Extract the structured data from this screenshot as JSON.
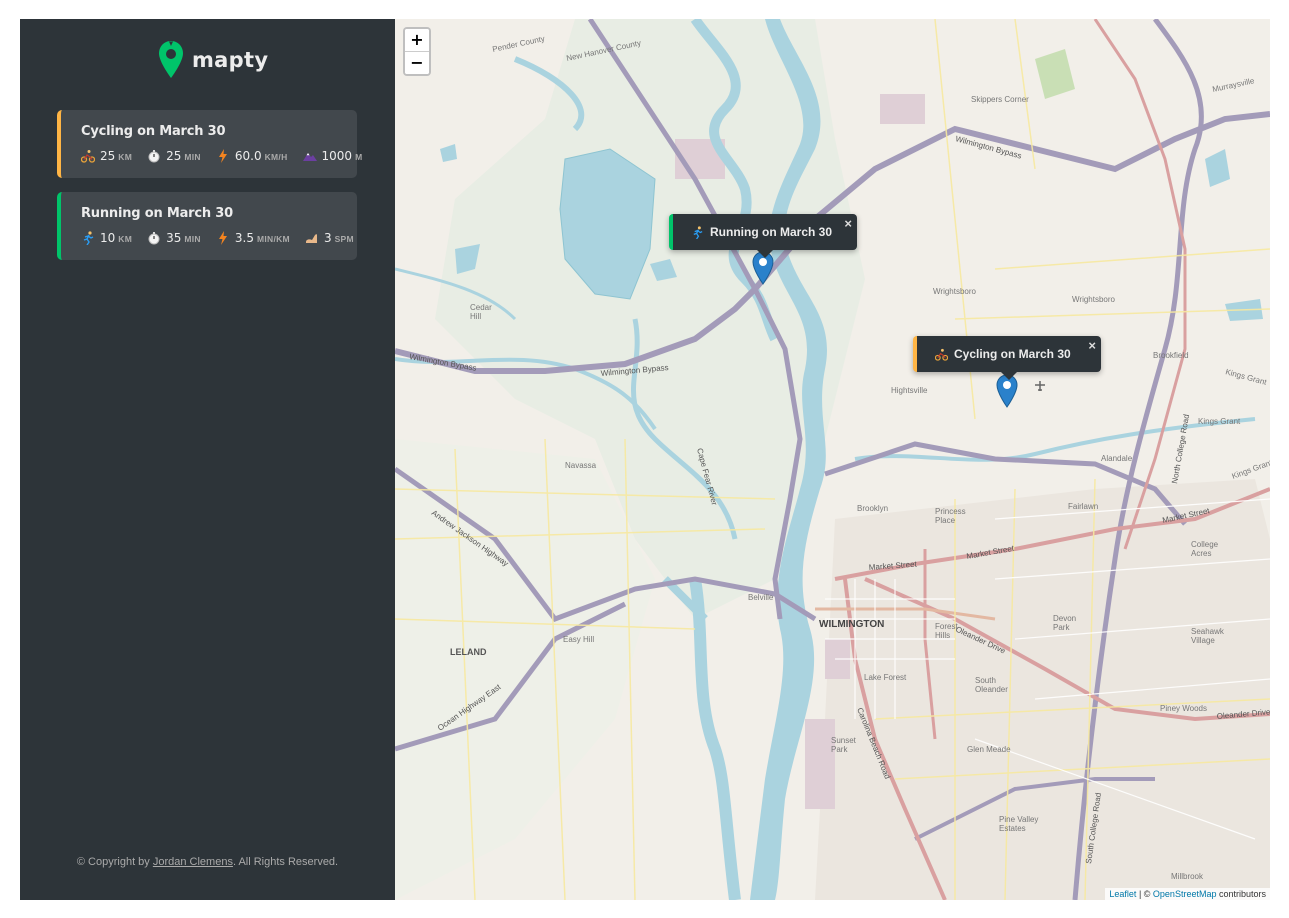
{
  "app": {
    "name": "mapty"
  },
  "workouts": [
    {
      "type": "cycling",
      "title": "Cycling on March 30",
      "distance": "25",
      "distance_unit": "km",
      "duration": "25",
      "duration_unit": "min",
      "speed": "60.0",
      "speed_unit": "km/h",
      "elevation": "1000",
      "elevation_unit": "m"
    },
    {
      "type": "running",
      "title": "Running on March 30",
      "distance": "10",
      "distance_unit": "km",
      "duration": "35",
      "duration_unit": "min",
      "pace": "3.5",
      "pace_unit": "min/km",
      "cadence": "3",
      "cadence_unit": "spm"
    }
  ],
  "footer": {
    "prefix": "© Copyright by ",
    "author": "Jordan Clemens",
    "suffix": ". All Rights Reserved."
  },
  "map": {
    "zoom_in": "+",
    "zoom_out": "−",
    "popups": [
      {
        "label": "Running on March 30",
        "close": "×"
      },
      {
        "label": "Cycling on March 30",
        "close": "×"
      }
    ],
    "attribution": {
      "leaflet": "Leaflet",
      "sep": " | © ",
      "osm": "OpenStreetMap",
      "suffix": " contributors"
    },
    "labels": {
      "wilmington": "WILMINGTON",
      "leland": "LELAND",
      "wilmington_bypass_1": "Wilmington Bypass",
      "wilmington_bypass_2": "Wilmington Bypass",
      "wilmington_bypass_3": "Wilmington Bypass",
      "market_street_1": "Market Street",
      "market_street_2": "Market Street",
      "market_street_3": "Market Street",
      "pender_county": "Pender County",
      "new_hanover_county": "New Hanover County",
      "skippers_corner": "Skippers Corner",
      "murraysville": "Murraysville",
      "wrightsboro_1": "Wrightsboro",
      "wrightsboro_2": "Wrightsboro",
      "brookfield": "Brookfield",
      "kings_grant_1": "Kings Grant",
      "kings_grant_2": "Kings Grant",
      "kings_grant_3": "Kings Grant",
      "hightsville": "Hightsville",
      "cedar_hill": "Cedar\nHill",
      "navassa": "Navassa",
      "brooklyn": "Brooklyn",
      "princess_place": "Princess\nPlace",
      "fairlawn": "Fairlawn",
      "alandale": "Alandale",
      "college_acres": "College\nAcres",
      "devon_park": "Devon\nPark",
      "seahawk_village": "Seahawk\nVillage",
      "lake_forest": "Lake Forest",
      "south_oleander": "South\nOleander",
      "piney_woods": "Piney Woods",
      "oleander_drive_1": "Oleander Drive",
      "oleander_drive_2": "Oleander Drive",
      "glen_meade": "Glen Meade",
      "sunset_park": "Sunset\nPark",
      "pine_valley": "Pine Valley\nEstates",
      "millbrook": "Millbrook",
      "easy_hill": "Easy Hill",
      "belville": "Belville",
      "andrew_jackson": "Andrew Jackson Highway",
      "ocean_highway": "Ocean Highway East",
      "carolina_beach": "Carolina Beach Road",
      "north_college": "North College Road",
      "south_college": "South College Road",
      "cape_fear_river": "Cape Fear River",
      "forest_hills": "Forest\nHills"
    }
  }
}
